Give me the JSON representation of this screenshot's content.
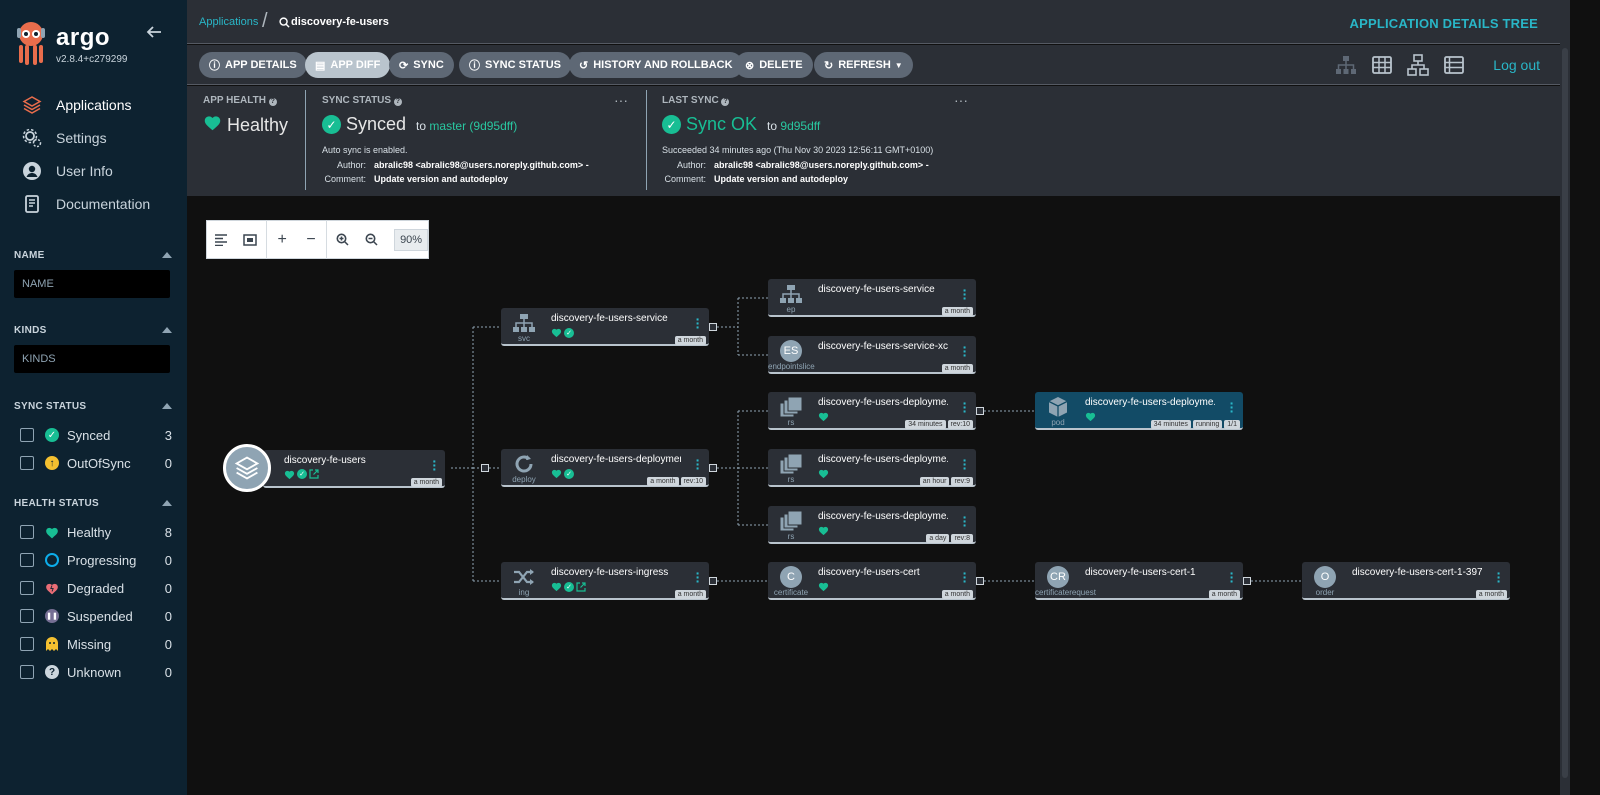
{
  "app": {
    "logo_text": "argo",
    "version": "v2.8.4+c279299"
  },
  "nav": [
    {
      "label": "Applications"
    },
    {
      "label": "Settings"
    },
    {
      "label": "User Info"
    },
    {
      "label": "Documentation"
    }
  ],
  "filters": {
    "name": {
      "title": "NAME",
      "placeholder": "NAME"
    },
    "kinds": {
      "title": "KINDS",
      "placeholder": "KINDS"
    },
    "sync_status": {
      "title": "SYNC STATUS",
      "items": [
        {
          "label": "Synced",
          "count": "3"
        },
        {
          "label": "OutOfSync",
          "count": "0"
        }
      ]
    },
    "health_status": {
      "title": "HEALTH STATUS",
      "items": [
        {
          "label": "Healthy",
          "count": "8"
        },
        {
          "label": "Progressing",
          "count": "0"
        },
        {
          "label": "Degraded",
          "count": "0"
        },
        {
          "label": "Suspended",
          "count": "0"
        },
        {
          "label": "Missing",
          "count": "0"
        },
        {
          "label": "Unknown",
          "count": "0"
        }
      ]
    }
  },
  "breadcrumb": {
    "parent": "Applications",
    "current": "discovery-fe-users"
  },
  "page_title": "APPLICATION DETAILS TREE",
  "toolbar": {
    "app_details": "APP DETAILS",
    "app_diff": "APP DIFF",
    "sync": "SYNC",
    "sync_status": "SYNC STATUS",
    "history": "HISTORY AND ROLLBACK",
    "delete": "DELETE",
    "refresh": "REFRESH",
    "logout": "Log out"
  },
  "status": {
    "app_health": {
      "title": "APP HEALTH",
      "value": "Healthy"
    },
    "sync_status": {
      "title": "SYNC STATUS",
      "value": "Synced",
      "to": "to",
      "revision": "master (9d95dff)",
      "auto_sync": "Auto sync is enabled.",
      "author_label": "Author:",
      "author": "abralic98 <abralic98@users.noreply.github.com> -",
      "comment_label": "Comment:",
      "comment": "Update version and autodeploy"
    },
    "last_sync": {
      "title": "LAST SYNC",
      "value": "Sync OK",
      "to": "to",
      "revision": "9d95dff",
      "succeeded": "Succeeded 34 minutes ago (Thu Nov 30 2023 12:56:11 GMT+0100)",
      "author_label": "Author:",
      "author": "abralic98 <abralic98@users.noreply.github.com> -",
      "comment_label": "Comment:",
      "comment": "Update version and autodeploy"
    },
    "dots": "···"
  },
  "zoom": {
    "level": "90%"
  },
  "colors": {
    "accent": "#29b6c7",
    "healthy": "#18be94",
    "sidebar": "#0d2230",
    "panel": "#2b2f36",
    "pod": "#124b66"
  },
  "graph": {
    "root": {
      "title": "discovery-fe-users",
      "tags": [
        "a month"
      ]
    },
    "nodes": [
      {
        "id": "svc",
        "kind": "svc",
        "title": "discovery-fe-users-service",
        "tags": [
          "a month"
        ]
      },
      {
        "id": "deploy",
        "kind": "deploy",
        "title": "discovery-fe-users-deployment",
        "tags": [
          "a month",
          "rev:10"
        ]
      },
      {
        "id": "ing",
        "kind": "ing",
        "title": "discovery-fe-users-ingress",
        "tags": [
          "a month"
        ]
      },
      {
        "id": "ep",
        "kind": "ep",
        "title": "discovery-fe-users-service",
        "tags": [
          "a month"
        ]
      },
      {
        "id": "es",
        "kind": "endpointslice",
        "badge": "ES",
        "title": "discovery-fe-users-service-xc...",
        "tags": [
          "a month"
        ]
      },
      {
        "id": "rs1",
        "kind": "rs",
        "title": "discovery-fe-users-deployme...",
        "tags": [
          "34 minutes",
          "rev:10"
        ]
      },
      {
        "id": "rs2",
        "kind": "rs",
        "title": "discovery-fe-users-deployme...",
        "tags": [
          "an hour",
          "rev:9"
        ]
      },
      {
        "id": "rs3",
        "kind": "rs",
        "title": "discovery-fe-users-deployme...",
        "tags": [
          "a day",
          "rev:8"
        ]
      },
      {
        "id": "cert",
        "kind": "certificate",
        "badge": "C",
        "title": "discovery-fe-users-cert",
        "tags": [
          "a month"
        ]
      },
      {
        "id": "pod",
        "kind": "pod",
        "title": "discovery-fe-users-deployme...",
        "tags": [
          "34 minutes",
          "running",
          "1/1"
        ]
      },
      {
        "id": "cr",
        "kind": "certificaterequest",
        "badge": "CR",
        "title": "discovery-fe-users-cert-1",
        "tags": [
          "a month"
        ]
      },
      {
        "id": "order",
        "kind": "order",
        "badge": "O",
        "title": "discovery-fe-users-cert-1-397...",
        "tags": [
          "a month"
        ]
      }
    ]
  }
}
